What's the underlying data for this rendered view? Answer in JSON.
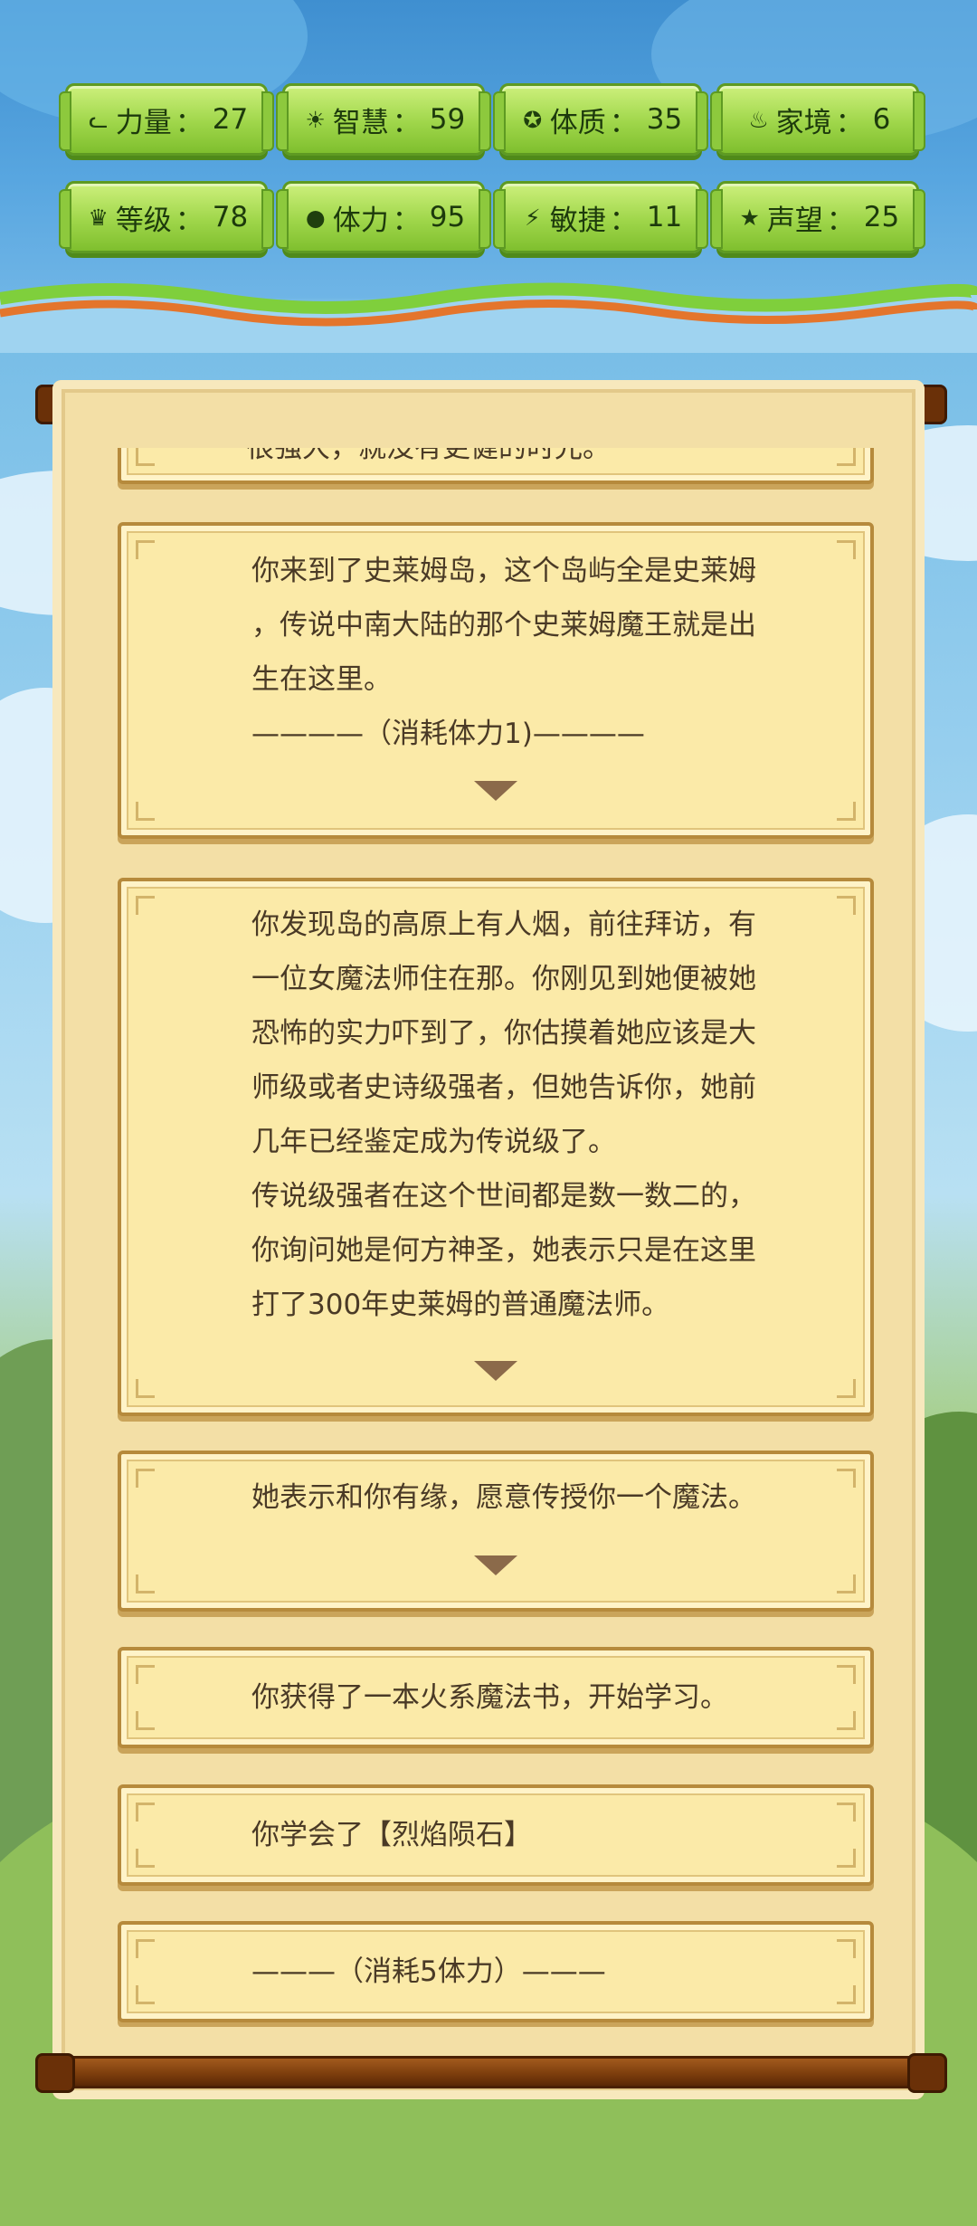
{
  "stats": [
    {
      "icon": "muscle-icon",
      "glyph": "ᓚ",
      "label": "力量",
      "sep": "：",
      "value": "27"
    },
    {
      "icon": "bulb-icon",
      "glyph": "☀",
      "label": "智慧",
      "sep": "：",
      "value": "59"
    },
    {
      "icon": "constitution-icon",
      "glyph": "✪",
      "label": "体质",
      "sep": "：",
      "value": "35"
    },
    {
      "icon": "family-icon",
      "glyph": "♨",
      "label": "家境",
      "sep": "：",
      "value": "6"
    },
    {
      "icon": "crown-icon",
      "glyph": "♛",
      "label": "等级",
      "sep": "：",
      "value": "78"
    },
    {
      "icon": "heart-icon",
      "glyph": "●",
      "label": "体力",
      "sep": "：",
      "value": "95"
    },
    {
      "icon": "lightning-icon",
      "glyph": "⚡",
      "label": "敏捷",
      "sep": "：",
      "value": "11"
    },
    {
      "icon": "star-icon",
      "glyph": "★",
      "label": "声望",
      "sep": "：",
      "value": "25"
    }
  ],
  "events": [
    {
      "text": "很强大，就没有更健的时光。"
    },
    {
      "text": "你来到了史莱姆岛，这个岛屿全是史莱姆\n，传说中南大陆的那个史莱姆魔王就是出\n生在这里。\n————（消耗体力1)————"
    },
    {
      "text": "你发现岛的高原上有人烟，前往拜访，有\n一位女魔法师住在那。你刚见到她便被她\n恐怖的实力吓到了，你估摸着她应该是大\n师级或者史诗级强者，但她告诉你，她前\n几年已经鉴定成为传说级了。\n传说级强者在这个世间都是数一数二的，\n你询问她是何方神圣，她表示只是在这里\n打了300年史莱姆的普通魔法师。"
    },
    {
      "text": "她表示和你有缘，愿意传授你一个魔法。"
    },
    {
      "text": "你获得了一本火系魔法书，开始学习。"
    },
    {
      "text": "你学会了【烈焰陨石】"
    },
    {
      "text": "———（消耗5体力）———"
    }
  ],
  "colors": {
    "stat_bg": "#a7d94c",
    "card_bg": "#fbeaa8",
    "text": "#4a3a26",
    "rod": "#7a3c0c"
  }
}
